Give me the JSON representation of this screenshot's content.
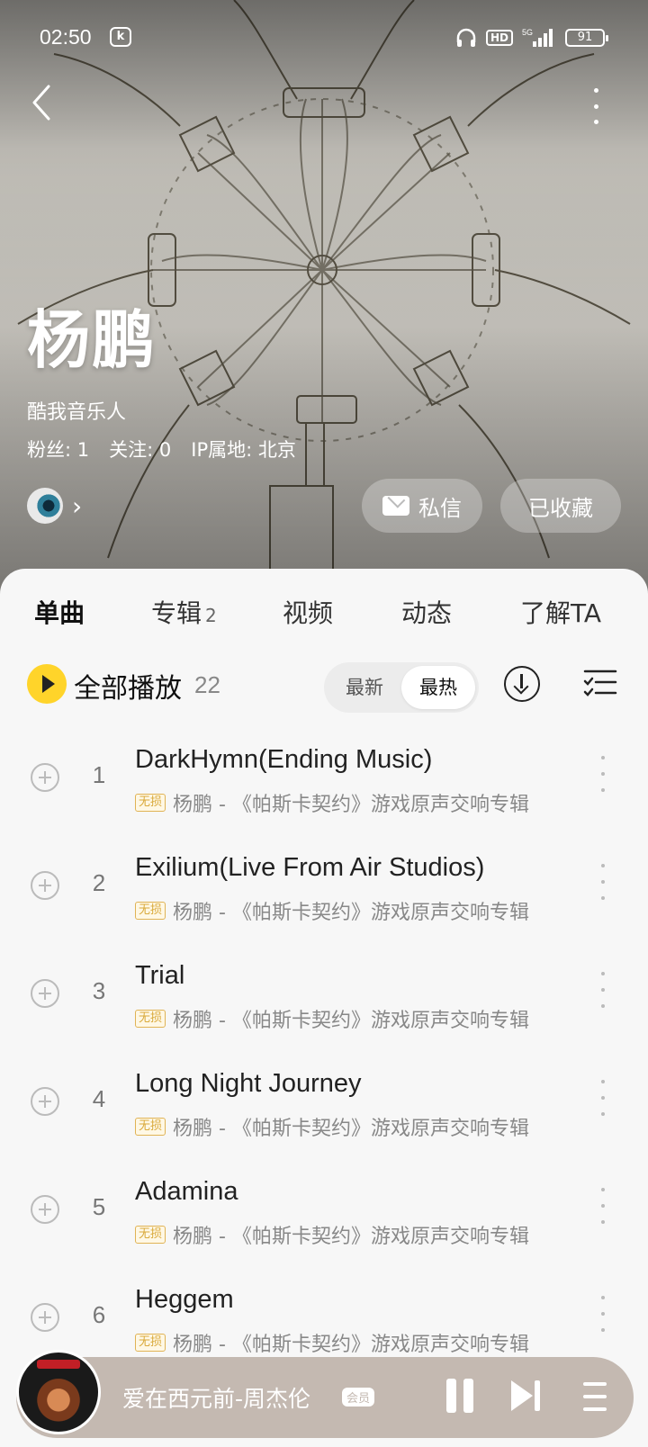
{
  "status_bar": {
    "time": "02:50",
    "notif_badge": "k",
    "net_label": "HD",
    "signal_label": "5G",
    "battery": "91"
  },
  "artist": {
    "name": "杨鹏",
    "subtitle": "酷我音乐人",
    "fans_label": "粉丝: 1",
    "following_label": "关注: 0",
    "ip_label": "IP属地: 北京"
  },
  "actions": {
    "message_label": "私信",
    "favorite_label": "已收藏"
  },
  "tabs": [
    {
      "label": "单曲",
      "count": ""
    },
    {
      "label": "专辑",
      "count": "2"
    },
    {
      "label": "视频",
      "count": ""
    },
    {
      "label": "动态",
      "count": ""
    },
    {
      "label": "了解TA",
      "count": ""
    }
  ],
  "play_all": {
    "label": "全部播放",
    "count": "22"
  },
  "sort": {
    "newest_label": "最新",
    "hottest_label": "最热",
    "selected": "最热"
  },
  "songs": [
    {
      "num": "1",
      "title": "DarkHymn(Ending Music)",
      "badge": "无损",
      "artist": "杨鹏 - 《帕斯卡契约》游戏原声交响专辑"
    },
    {
      "num": "2",
      "title": "Exilium(Live From Air Studios)",
      "badge": "无损",
      "artist": "杨鹏 - 《帕斯卡契约》游戏原声交响专辑"
    },
    {
      "num": "3",
      "title": "Trial",
      "badge": "无损",
      "artist": "杨鹏 - 《帕斯卡契约》游戏原声交响专辑"
    },
    {
      "num": "4",
      "title": "Long Night Journey",
      "badge": "无损",
      "artist": "杨鹏 - 《帕斯卡契约》游戏原声交响专辑"
    },
    {
      "num": "5",
      "title": "Adamina",
      "badge": "无损",
      "artist": "杨鹏 - 《帕斯卡契约》游戏原声交响专辑"
    },
    {
      "num": "6",
      "title": "Heggem",
      "badge": "无损",
      "artist": "杨鹏 - 《帕斯卡契约》游戏原声交响专辑"
    }
  ],
  "mini_player": {
    "now_playing": "爱在西元前-周杰伦",
    "vip_label": "会员"
  },
  "colors": {
    "accent": "#ffd42a",
    "lossless": "#d9a93a",
    "player_bg": "#c4b9b1"
  },
  "icons": {
    "back": "back-arrow-icon",
    "more": "more-vertical-icon",
    "mail": "mail-icon",
    "play": "play-icon",
    "download": "download-icon",
    "multiselect": "checklist-icon",
    "add": "add-circle-icon",
    "pause": "pause-icon",
    "next": "skip-next-icon",
    "playlist": "playlist-icon"
  }
}
